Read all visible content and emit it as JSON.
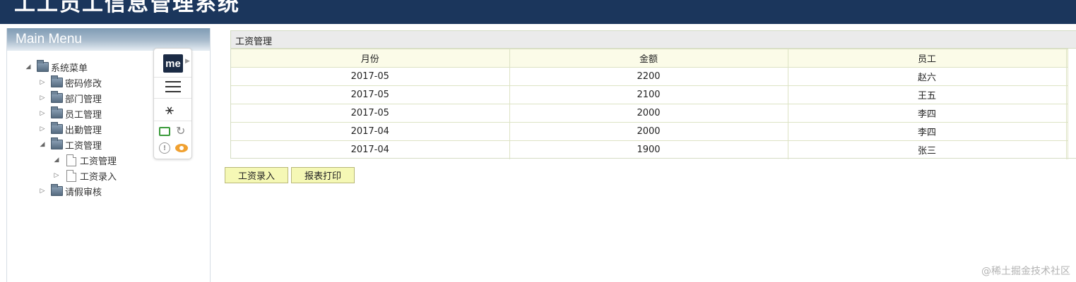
{
  "app": {
    "title": "工工员工信息管理系统"
  },
  "sidebar": {
    "title": "Main Menu",
    "tree": [
      {
        "label": "系统菜单",
        "expanded": true,
        "type": "folder",
        "level": 0
      },
      {
        "label": "密码修改",
        "expanded": false,
        "type": "folder",
        "level": 1
      },
      {
        "label": "部门管理",
        "expanded": false,
        "type": "folder",
        "level": 1
      },
      {
        "label": "员工管理",
        "expanded": false,
        "type": "folder",
        "level": 1
      },
      {
        "label": "出勤管理",
        "expanded": false,
        "type": "folder",
        "level": 1
      },
      {
        "label": "工资管理",
        "expanded": true,
        "type": "folder",
        "level": 1
      },
      {
        "label": "工资管理",
        "expanded": true,
        "type": "file",
        "level": 2
      },
      {
        "label": "工资录入",
        "expanded": false,
        "type": "file",
        "level": 2
      },
      {
        "label": "请假审核",
        "expanded": false,
        "type": "folder",
        "level": 1
      }
    ]
  },
  "extension": {
    "logo_text": "me",
    "icons": [
      "menu-icon",
      "magic-wand-icon",
      "cast-icon",
      "refresh-icon",
      "info-icon",
      "eye-icon"
    ],
    "colors": {
      "logo_bg": "#1b2b45",
      "cast": "#3a9a3a",
      "eye": "#f0a030"
    }
  },
  "panel": {
    "title": "工资管理",
    "columns": [
      "月份",
      "金额",
      "员工"
    ],
    "rows": [
      [
        "2017-05",
        "2200",
        "赵六"
      ],
      [
        "2017-05",
        "2100",
        "王五"
      ],
      [
        "2017-05",
        "2000",
        "李四"
      ],
      [
        "2017-04",
        "2000",
        "李四"
      ],
      [
        "2017-04",
        "1900",
        "张三"
      ]
    ]
  },
  "actions": {
    "entry_label": "工资录入",
    "print_label": "报表打印"
  },
  "watermark": "@稀土掘金技术社区",
  "colors": {
    "topbar": "#1b365c",
    "button_bg": "#f5f8b5",
    "table_header_bg": "#fbfbe8"
  }
}
